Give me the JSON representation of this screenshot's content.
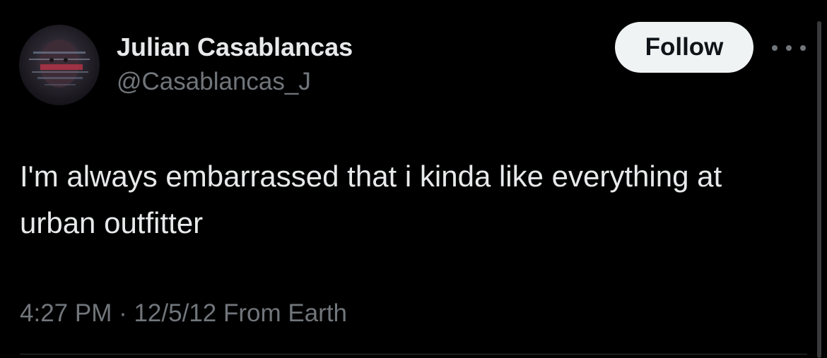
{
  "user": {
    "display_name": "Julian Casablancas",
    "handle": "@Casablancas_J",
    "avatar_icon": "avatar-photo"
  },
  "actions": {
    "follow_label": "Follow",
    "more_icon": "more-options-icon"
  },
  "tweet": {
    "text": "I'm always embarrassed that i kinda like everything at urban outfitter",
    "time": "4:27 PM",
    "separator": " · ",
    "date": "12/5/12",
    "source": " From Earth"
  },
  "colors": {
    "background": "#000000",
    "primary_text": "#e7e9ea",
    "secondary_text": "#71767b",
    "follow_button_bg": "#eff3f4",
    "follow_button_text": "#0f1419"
  }
}
